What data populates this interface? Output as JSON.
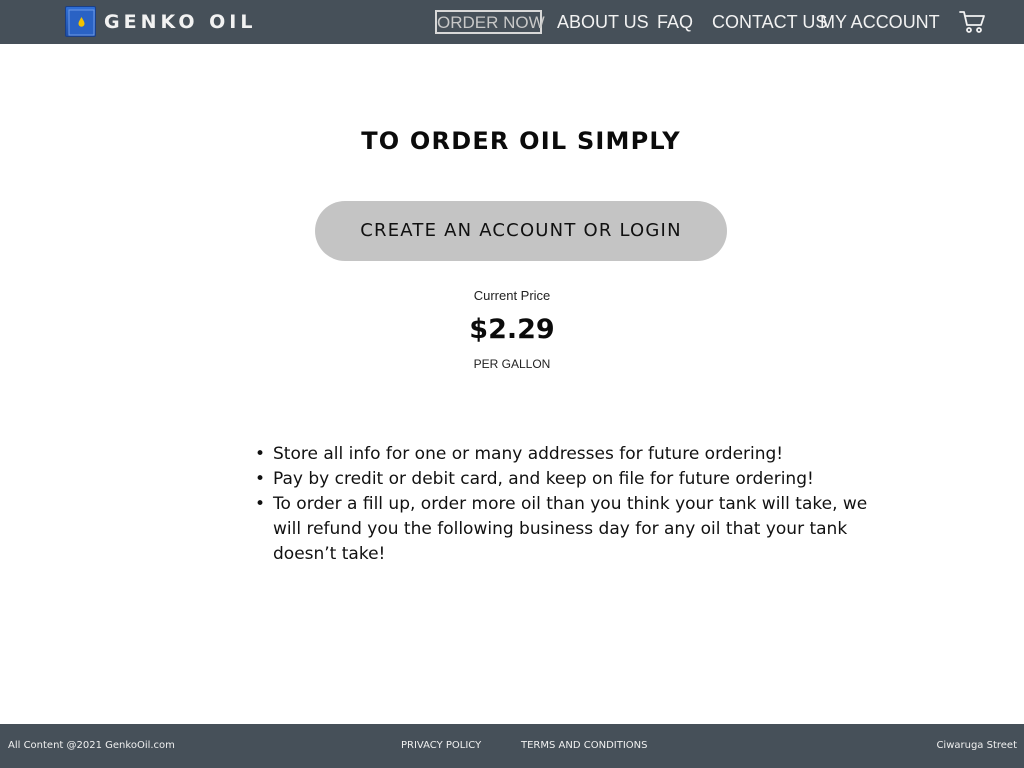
{
  "header": {
    "brand": "GENKO OIL",
    "nav": {
      "order_now": "ORDER NOW",
      "about_us": "ABOUT US",
      "faq": "FAQ",
      "contact_us": "CONTACT US",
      "my_account": "MY ACCOUNT"
    },
    "icons": {
      "logo": "oil-drop-logo-icon",
      "cart": "shopping-cart-icon"
    }
  },
  "main": {
    "title": "TO ORDER OIL SIMPLY",
    "cta_label": "CREATE AN ACCOUNT OR LOGIN",
    "price": {
      "label": "Current Price",
      "value": "$2.29",
      "unit": "PER GALLON"
    },
    "features": [
      "Store all info for one or many addresses for future ordering!",
      "Pay by credit or debit card, and keep on file for future ordering!",
      "To order a fill up, order more oil than you think your tank will take, we will refund you the following business day for any oil that your tank doesn’t take!"
    ]
  },
  "footer": {
    "copyright": "All Content @2021 GenkoOil.com",
    "privacy": "PRIVACY POLICY",
    "terms": "TERMS AND CONDITIONS",
    "street": "Ciwaruga Street"
  },
  "colors": {
    "header_bg": "#465059",
    "cta_bg": "#c4c4c4",
    "logo_blue": "#2f6fd6",
    "logo_drop": "#f2c200"
  }
}
